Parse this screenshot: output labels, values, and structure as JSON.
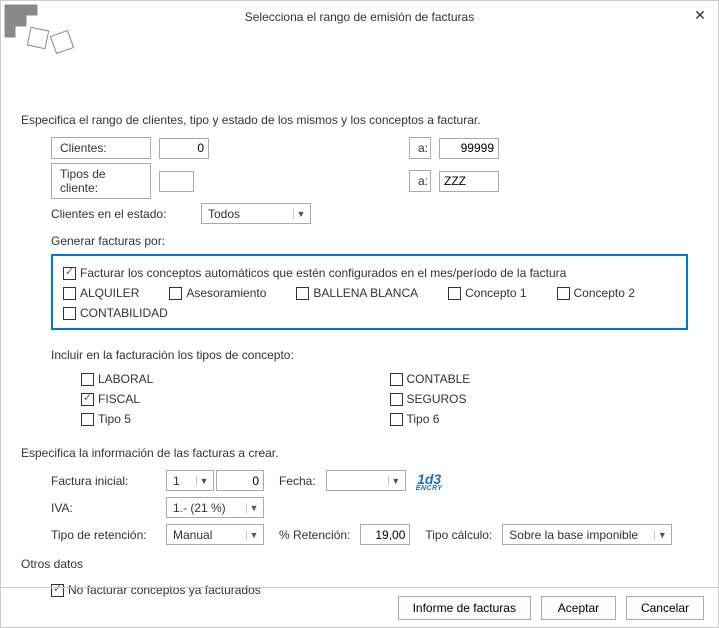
{
  "window": {
    "title": "Selecciona el rango de emisión de facturas"
  },
  "section1": {
    "intro": "Especifica el rango de clientes, tipo y estado de los mismos y los conceptos a facturar.",
    "clients_label": "Clientes:",
    "clients_from": "0",
    "a": "a:",
    "clients_to": "99999",
    "tipos_label": "Tipos de cliente:",
    "tipos_from": "",
    "tipos_to": "ZZZ",
    "estado_label": "Clientes en el estado:",
    "estado_value": "Todos",
    "generar_label": "Generar facturas por:",
    "auto_label": "Facturar los conceptos automáticos que estén configurados en el mes/período de la factura",
    "concepts": [
      "ALQUILER",
      "Asesoramiento",
      "BALLENA BLANCA",
      "Concepto 1",
      "Concepto 2",
      "CONTABILIDAD"
    ]
  },
  "section2": {
    "intro": "Incluir en la facturación los tipos de concepto:",
    "col1": [
      "LABORAL",
      "FISCAL",
      "Tipo 5"
    ],
    "col2": [
      "CONTABLE",
      "SEGUROS",
      "Tipo 6"
    ],
    "checked": "FISCAL"
  },
  "section3": {
    "intro": "Especifica la información de las facturas a crear.",
    "factura_inicial_label": "Factura inicial:",
    "factura_serie": "1",
    "factura_num": "0",
    "fecha_label": "Fecha:",
    "fecha_value": "",
    "iva_label": "IVA:",
    "iva_value": "1.- (21 %)",
    "retencion_tipo_label": "Tipo de retención:",
    "retencion_tipo_value": "Manual",
    "retencion_pct_label": "% Retención:",
    "retencion_pct_value": "19,00",
    "tipo_calc_label": "Tipo cálculo:",
    "tipo_calc_value": "Sobre la base imponible"
  },
  "section4": {
    "intro": "Otros datos",
    "no_facturar": "No facturar conceptos ya facturados"
  },
  "buttons": {
    "informe": "Informe de facturas",
    "aceptar": "Aceptar",
    "cancelar": "Cancelar"
  }
}
